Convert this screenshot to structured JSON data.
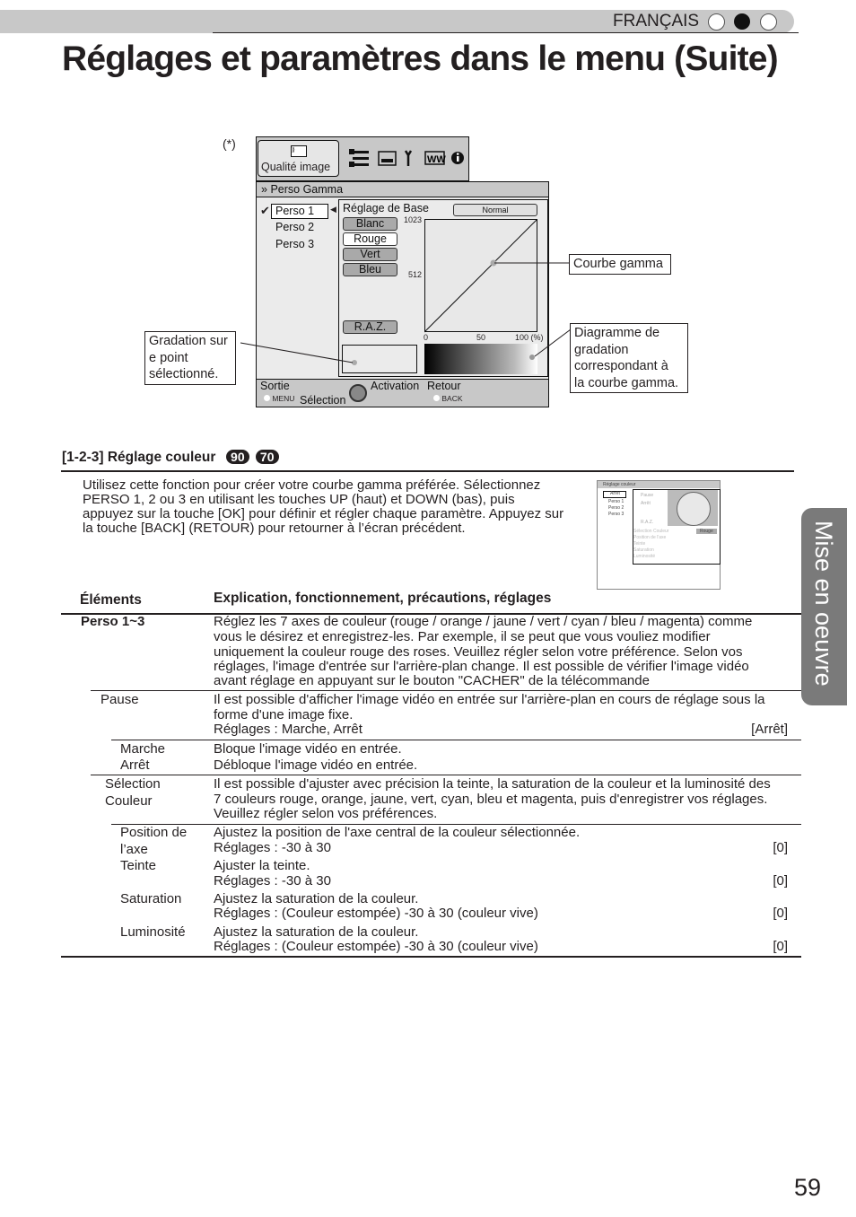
{
  "header": {
    "language": "FRANÇAIS",
    "language_dots": [
      "empty",
      "filled",
      "empty"
    ]
  },
  "title": "Réglages et paramètres dans le menu (Suite)",
  "diagram": {
    "footnote_marker": "(*)",
    "tab_label": "Qualité image",
    "tab_icons": [
      "picture-icon",
      "sliders-icon",
      "screen-icon",
      "wrench-icon",
      "grid-icon",
      "info-icon"
    ],
    "breadcrumb": "Perso Gamma",
    "perso_list": [
      "Perso 1",
      "Perso 2",
      "Perso 3"
    ],
    "base_label": "Réglage de Base",
    "base_value": "Normal",
    "color_buttons": [
      "Blanc",
      "Rouge",
      "Vert",
      "Bleu"
    ],
    "reset_button": "R.A.Z.",
    "y_labels": [
      "1023",
      "512"
    ],
    "x_labels": [
      "0",
      "50",
      "100 (%)"
    ],
    "footer": {
      "exit": "Sortie",
      "menu": "MENU",
      "select": "Sélection",
      "activate": "Activation",
      "back": "Retour",
      "back_key": "BACK"
    },
    "callouts": {
      "curve": "Courbe gamma",
      "gradation_diagram": [
        "Diagramme de",
        "gradation",
        "correspondant à",
        "la courbe gamma."
      ],
      "gradation_point": [
        "Gradation sur",
        "e point",
        "sélectionné."
      ]
    }
  },
  "section": {
    "heading": "[1-2-3] Réglage couleur",
    "badges": [
      "90",
      "70"
    ],
    "intro": [
      "Utilisez cette fonction pour créer votre courbe gamma préférée. Sélectionnez",
      "PERSO 1, 2 ou 3 en utilisant les touches UP (haut) et DOWN (bas), puis",
      "appuyez sur la touche [OK] pour définir et régler chaque paramètre. Appuyez sur",
      "la touche [BACK] (RETOUR) pour retourner à l’écran précédent."
    ]
  },
  "thumbnail": {
    "title": "Réglage couleur",
    "selected": "Arrêt",
    "list": [
      "Perso 1",
      "Perso 2",
      "Perso 3"
    ],
    "buttons": [
      "Pause",
      "Arrêt",
      "R.A.Z."
    ],
    "rows": [
      "Sélection Couleur",
      "Position de l'axe",
      "Teinte",
      "Saturation",
      "Luminosité"
    ],
    "color_value": "Rouge"
  },
  "table": {
    "headers": [
      "Éléments",
      "Explication, fonctionnement, précautions, réglages"
    ],
    "perso": {
      "label": "Perso 1~3",
      "lines": [
        "Réglez les 7 axes de couleur (rouge / orange / jaune / vert / cyan / bleu / magenta) comme",
        "vous le désirez et enregistrez-les. Par exemple, il se peut que vous vouliez modifier",
        "uniquement la couleur rouge des roses. Veuillez régler selon votre préférence. Selon vos",
        "réglages, l'image d'entrée sur l'arrière-plan change. Il est possible de vérifier l'image vidéo",
        "avant réglage en appuyant sur le bouton \"CACHER\" de la télécommande"
      ]
    },
    "pause": {
      "label": "Pause",
      "lines": [
        "Il est possible d'afficher l'image vidéo en entrée sur l'arrière-plan en cours de réglage sous la",
        "forme d'une image fixe.",
        "Réglages : Marche, Arrêt"
      ],
      "default": "[Arrêt]"
    },
    "marche": {
      "label": "Marche",
      "text": "Bloque l'image vidéo en entrée."
    },
    "arret": {
      "label": "Arrêt",
      "text": "Débloque l'image vidéo en entrée."
    },
    "selection": {
      "label": [
        "Sélection",
        "Couleur"
      ],
      "lines": [
        "Il est possible d'ajuster avec précision la teinte, la saturation de la couleur et la luminosité des",
        "7 couleurs rouge, orange, jaune, vert, cyan, bleu et magenta, puis d'enregistrer vos réglages.",
        "Veuillez régler selon vos préférences."
      ]
    },
    "position": {
      "label": [
        "Position de",
        "l’axe"
      ],
      "lines": [
        "Ajustez la position de l'axe central de la couleur sélectionnée.",
        "Réglages : -30 à 30"
      ],
      "default": "[0]"
    },
    "teinte": {
      "label": "Teinte",
      "lines": [
        "Ajuster la teinte.",
        "Réglages : -30 à 30"
      ],
      "default": "[0]"
    },
    "saturation": {
      "label": "Saturation",
      "lines": [
        "Ajustez la saturation de la couleur.",
        "Réglages : (Couleur estompée) -30 à 30 (couleur vive)"
      ],
      "default": "[0]"
    },
    "luminosite": {
      "label": "Luminosité",
      "lines": [
        "Ajustez la saturation de la couleur.",
        "Réglages : (Couleur estompée) -30 à 30 (couleur vive)"
      ],
      "default": "[0]"
    }
  },
  "side_tab": "Mise en oeuvre",
  "page_number": "59"
}
